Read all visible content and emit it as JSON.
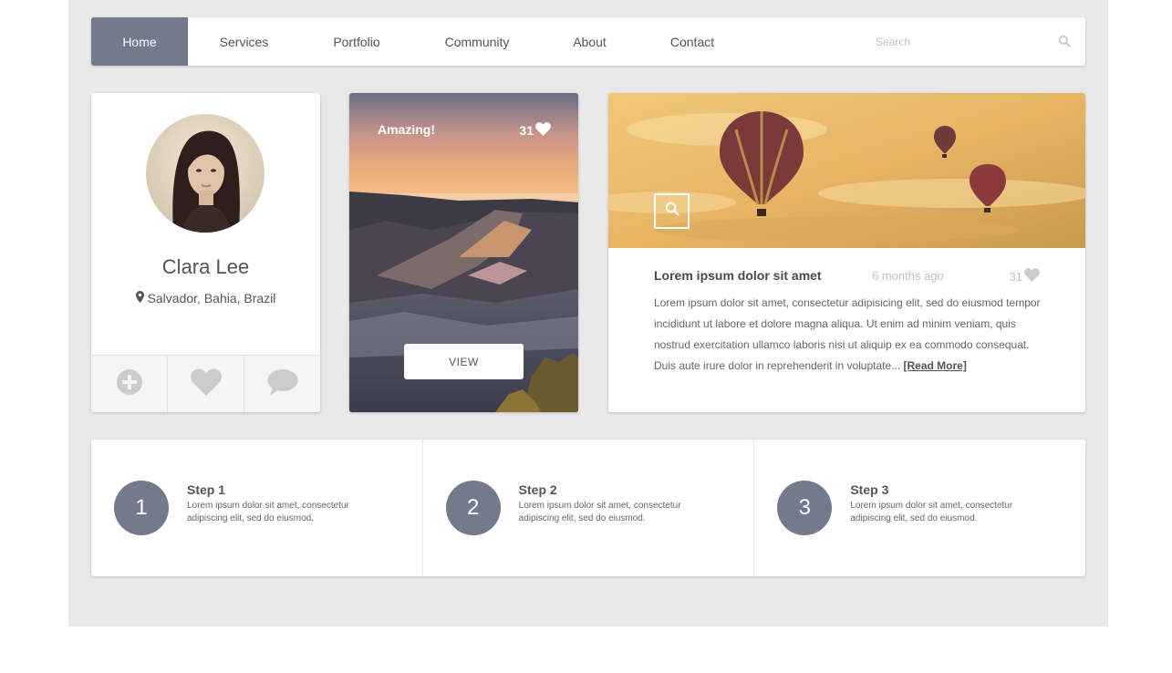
{
  "nav": {
    "items": [
      {
        "label": "Home",
        "active": true
      },
      {
        "label": "Services"
      },
      {
        "label": "Portfolio"
      },
      {
        "label": "Community"
      },
      {
        "label": "About"
      },
      {
        "label": "Contact"
      }
    ],
    "search_placeholder": "Search",
    "search_icon": "search-icon"
  },
  "profile": {
    "name": "Clara Lee",
    "location": "Salvador, Bahia, Brazil",
    "location_icon": "map-marker-icon",
    "actions": [
      {
        "icon": "plus-circle-icon"
      },
      {
        "icon": "heart-icon"
      },
      {
        "icon": "comment-icon"
      }
    ]
  },
  "photo_card": {
    "title": "Amazing!",
    "likes": "31",
    "button_label": "VIEW"
  },
  "blog": {
    "title": "Lorem ipsum dolor sit amet",
    "time": "6 months ago",
    "likes": "31",
    "text": "Lorem ipsum dolor sit amet, consectetur adipisicing elit, sed do eiusmod tempor incididunt ut labore et dolore magna aliqua. Ut enim ad minim veniam, quis nostrud exercitation ullamco laboris nisi ut aliquip ex ea commodo consequat. Duis aute irure dolor in reprehenderit in voluptate...",
    "read_more": "[Read More]"
  },
  "steps": [
    {
      "number": "1",
      "title": "Step 1",
      "text": "Lorem ipsum dolor sit amet, consectetur adipiscing elit, sed do eiusmod."
    },
    {
      "number": "2",
      "title": "Step 2",
      "text": "Lorem ipsum dolor sit amet, consectetur adipiscing elit, sed do eiusmod."
    },
    {
      "number": "3",
      "title": "Step 3",
      "text": "Lorem ipsum dolor sit amet, consectetur adipiscing elit, sed do eiusmod."
    }
  ],
  "colors": {
    "accent": "#727a8c",
    "background": "#e9e9e9",
    "icon_grey": "#cccccc"
  }
}
